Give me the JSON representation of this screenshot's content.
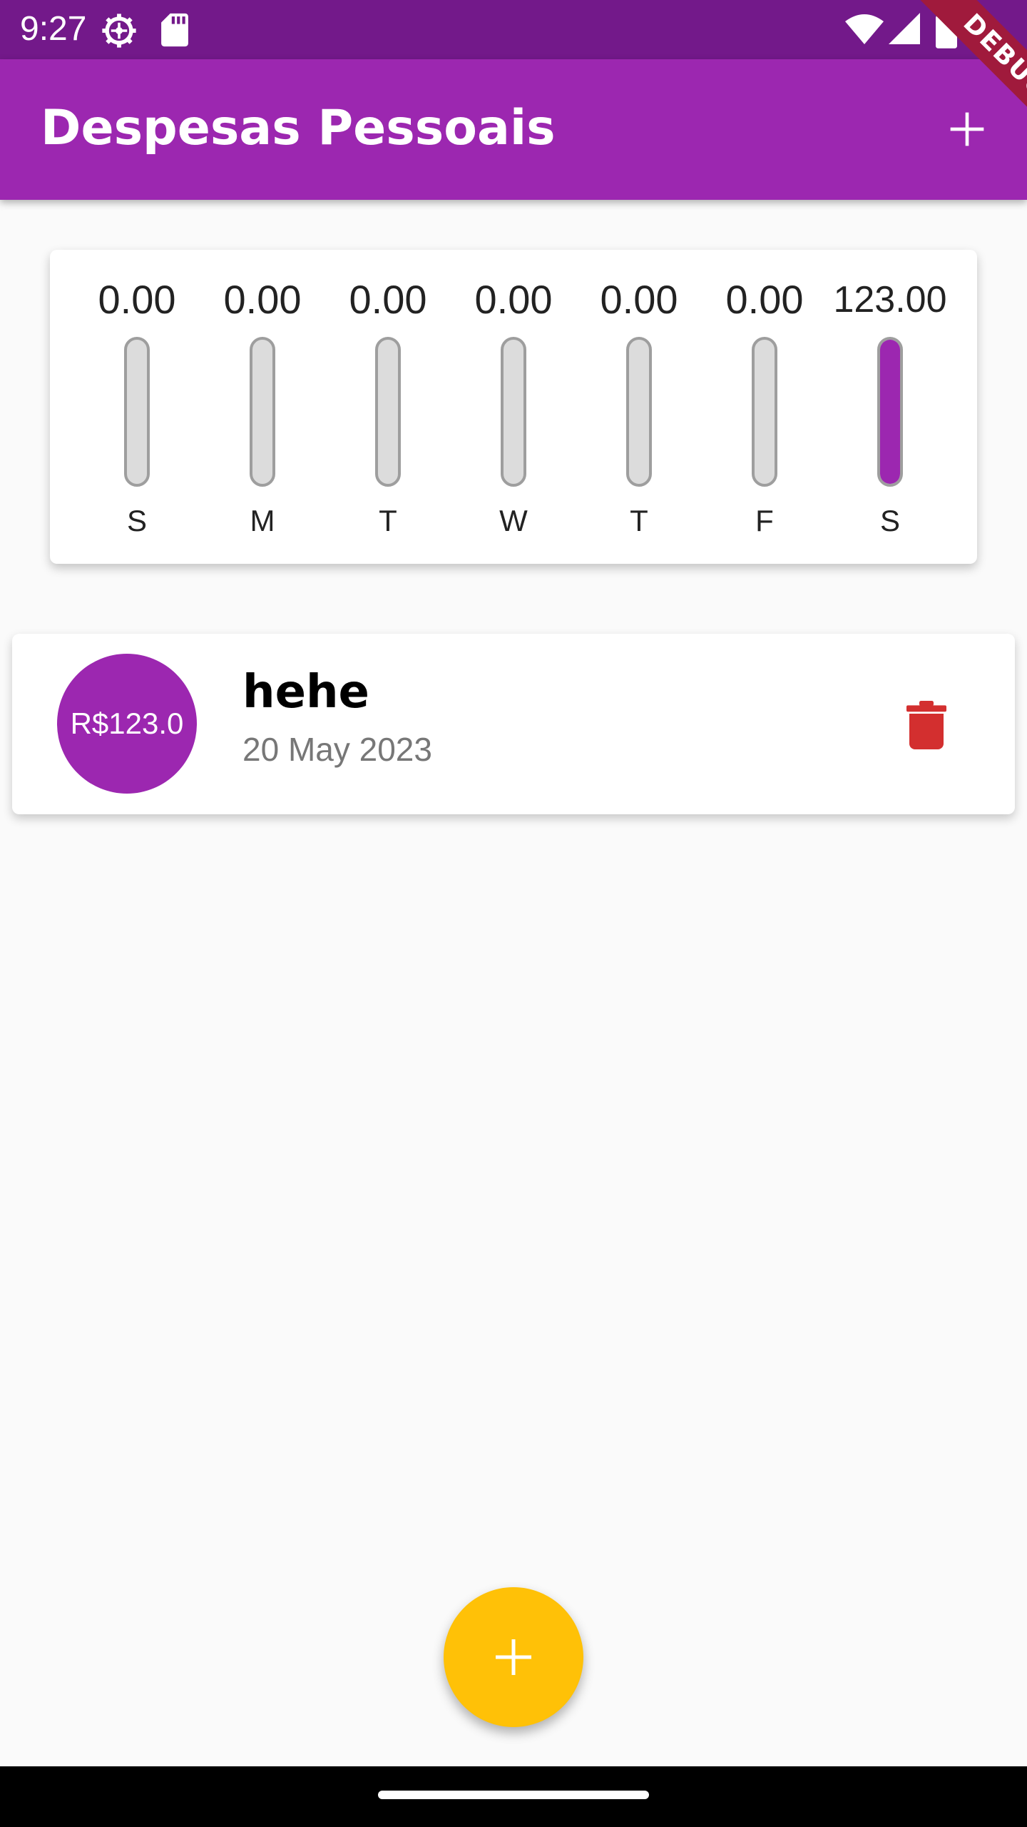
{
  "status_bar": {
    "time": "9:27",
    "icons": [
      "gear-icon",
      "sd-card-icon",
      "wifi-icon",
      "signal-icon",
      "battery-icon"
    ]
  },
  "debug_banner": {
    "label": "DEBUG"
  },
  "app_bar": {
    "title": "Despesas Pessoais",
    "action_icon": "add-icon",
    "background": "#9c27b0"
  },
  "chart": {
    "accent": "#9c27b0",
    "bars": [
      {
        "value": "0.00",
        "day": "S",
        "fraction": 0
      },
      {
        "value": "0.00",
        "day": "M",
        "fraction": 0
      },
      {
        "value": "0.00",
        "day": "T",
        "fraction": 0
      },
      {
        "value": "0.00",
        "day": "W",
        "fraction": 0
      },
      {
        "value": "0.00",
        "day": "T",
        "fraction": 0
      },
      {
        "value": "0.00",
        "day": "F",
        "fraction": 0
      },
      {
        "value": "123.00",
        "day": "S",
        "fraction": 1
      }
    ]
  },
  "transactions": [
    {
      "amount": "R$123.0",
      "title": "hehe",
      "date": "20 May 2023",
      "delete_icon": "trash-icon",
      "delete_color": "#d32f2f"
    }
  ],
  "fab": {
    "icon": "add-icon",
    "color": "#ffc107"
  }
}
